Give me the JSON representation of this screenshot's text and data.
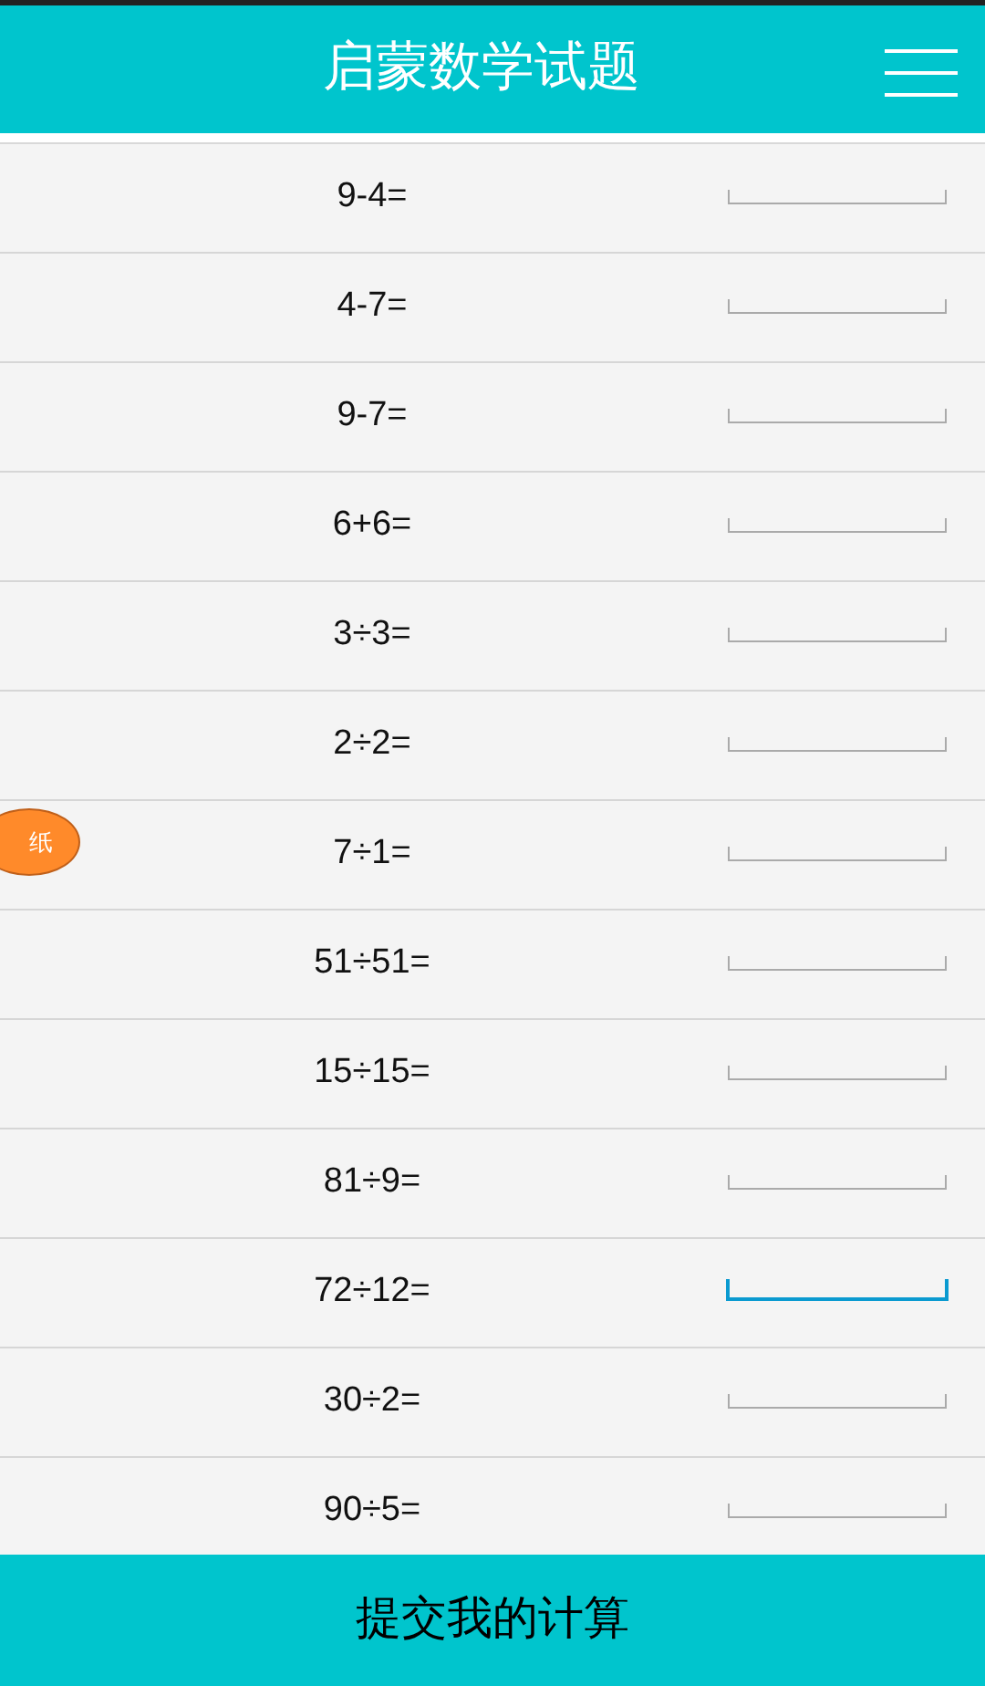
{
  "header": {
    "title": "启蒙数学试题"
  },
  "floating_button": {
    "label": "纸"
  },
  "questions": [
    {
      "text": "9-4=",
      "focused": false
    },
    {
      "text": "4-7=",
      "focused": false
    },
    {
      "text": "9-7=",
      "focused": false
    },
    {
      "text": "6+6=",
      "focused": false
    },
    {
      "text": "3÷3=",
      "focused": false
    },
    {
      "text": "2÷2=",
      "focused": false
    },
    {
      "text": "7÷1=",
      "focused": false
    },
    {
      "text": "51÷51=",
      "focused": false
    },
    {
      "text": "15÷15=",
      "focused": false
    },
    {
      "text": "81÷9=",
      "focused": false
    },
    {
      "text": "72÷12=",
      "focused": true
    },
    {
      "text": "30÷2=",
      "focused": false
    },
    {
      "text": "90÷5=",
      "focused": false
    }
  ],
  "submit_button": {
    "label": "提交我的计算"
  }
}
